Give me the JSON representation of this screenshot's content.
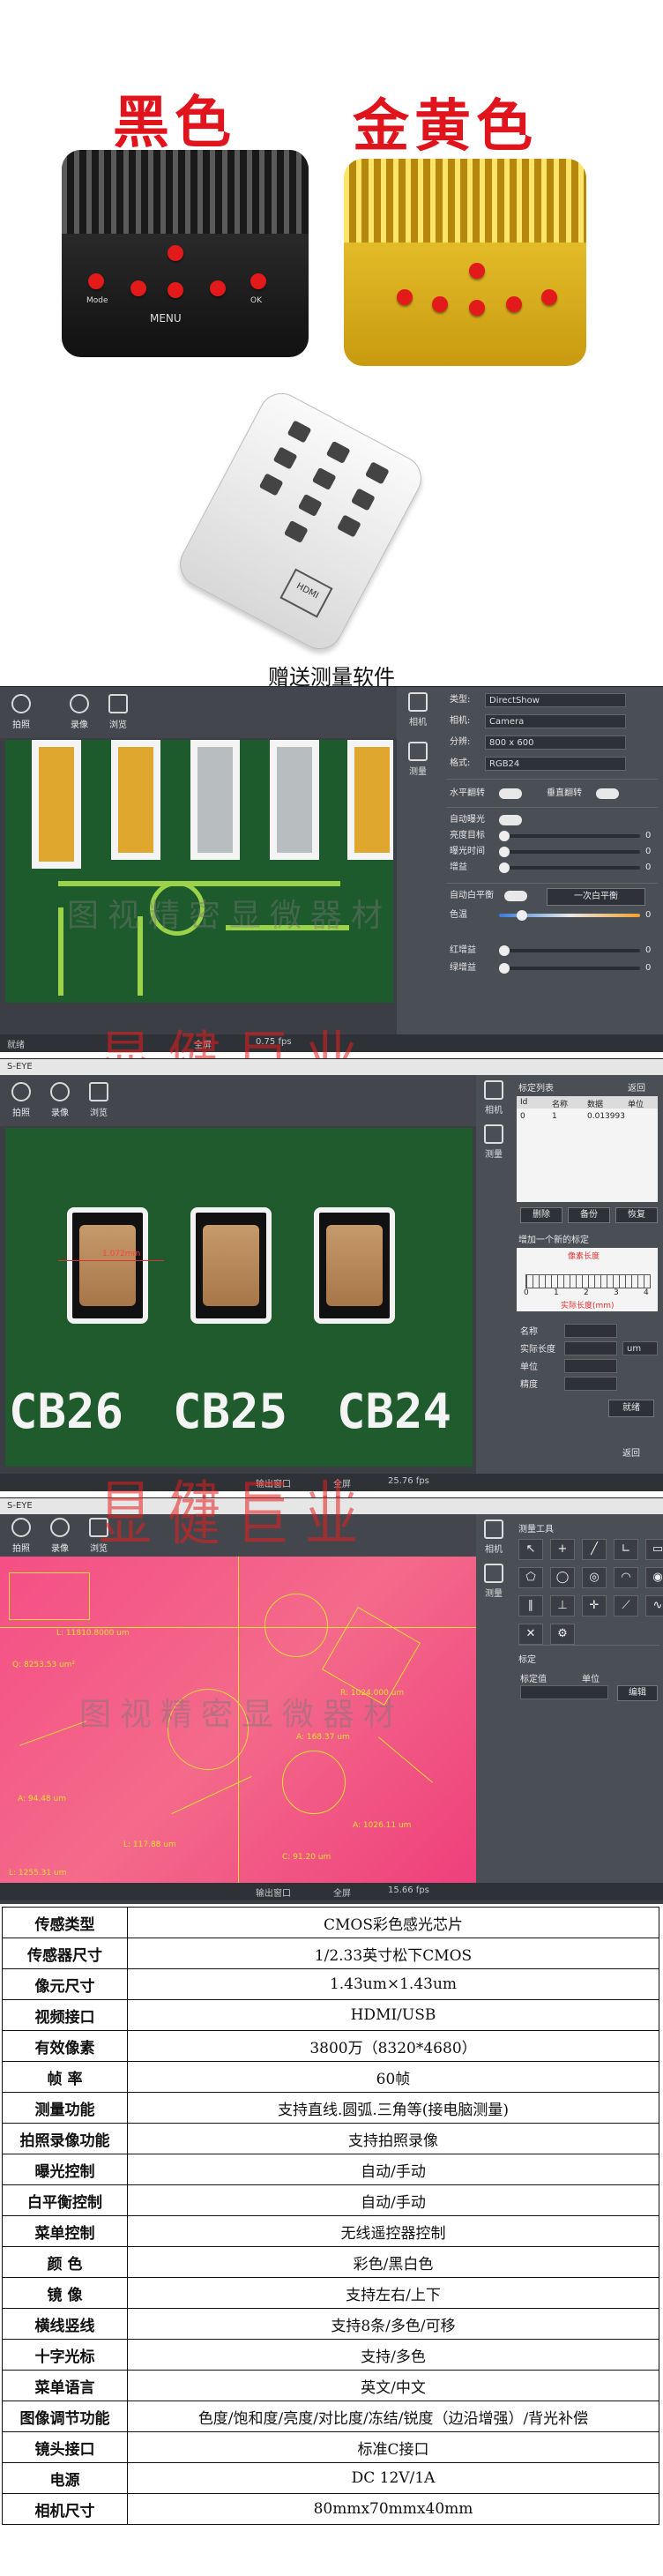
{
  "product": {
    "black_label": "黑色",
    "gold_label": "金黄色",
    "menu_label": "MENU",
    "button_labels": [
      "Mode",
      "OK"
    ],
    "remote_badge": "HDMI",
    "caption": "赠送测量软件"
  },
  "screens": [
    {
      "toolbar": [
        "拍照",
        "录像",
        "浏览"
      ],
      "side_tabs": [
        "相机",
        "测量"
      ],
      "fields": [
        {
          "label": "类型:",
          "value": "DirectShow"
        },
        {
          "label": "相机:",
          "value": "Camera"
        },
        {
          "label": "分辨:",
          "value": "800 x 600"
        },
        {
          "label": "格式:",
          "value": "RGB24"
        }
      ],
      "flip": [
        "水平翻转",
        "垂直翻转"
      ],
      "exposure": [
        {
          "label": "自动曝光",
          "value": ""
        },
        {
          "label": "亮度目标",
          "value": "0"
        },
        {
          "label": "曝光时间",
          "value": "0"
        },
        {
          "label": "增益",
          "value": "0"
        }
      ],
      "white_balance": {
        "label": "自动白平衡",
        "button": "一次白平衡"
      },
      "color": [
        {
          "label": "色温",
          "value": "0"
        },
        {
          "label": "红增益",
          "value": "0"
        },
        {
          "label": "绿增益",
          "value": "0"
        }
      ],
      "status": {
        "left": "就绪",
        "mid": "全屏",
        "fps": "0.75 fps"
      },
      "watermark": "图视精密显微器材"
    },
    {
      "app_title": "S-EYE",
      "toolbar": [
        "拍照",
        "录像",
        "浏览"
      ],
      "side_tabs": [
        "相机",
        "测量"
      ],
      "panel_header": "标定列表",
      "close_label": "返回",
      "table_headers": [
        "Id",
        "名称",
        "数据",
        "单位"
      ],
      "table_row": [
        "0",
        "1",
        "0.013993",
        ""
      ],
      "panel_buttons": [
        "删除",
        "备份",
        "恢复"
      ],
      "calib_title": "增加一个新的标定",
      "ruler_label": "像素长度",
      "ruler_bottom": "实际长度(mm)",
      "ruler_ticks": [
        "0",
        "1",
        "2",
        "3",
        "4"
      ],
      "fields": [
        "名称",
        "实际长度",
        "单位",
        "精度"
      ],
      "unit_value": "um",
      "confirm_button": "就绪",
      "bottom_button": "返回",
      "marker_label": "1.072mm",
      "chip_labels": [
        "CB26",
        "CB25",
        "CB24"
      ],
      "status": {
        "left": "输出窗口",
        "mid": "全屏",
        "fps": "25.76 fps"
      },
      "watermark": "显健巨业"
    },
    {
      "app_title": "S-EYE",
      "toolbar": [
        "拍照",
        "录像",
        "浏览"
      ],
      "side_tabs": [
        "相机",
        "测量"
      ],
      "panel_header": "测量工具",
      "calib_header": "标定",
      "calib_fields": [
        "标定值",
        "单位"
      ],
      "calib_button": "编辑",
      "measurements": [
        "L: 11810.8000 um",
        "Q: 8253.53 um²",
        "R: 1024.000 um",
        "A: 168.37 um",
        "L: 117.88 um",
        "C: 91.20 um",
        "A: 94.48 um",
        "L: 1255.31 um",
        "A: 1026.11 um"
      ],
      "status": {
        "left": "输出窗口",
        "mid": "全屏",
        "fps": "15.66 fps"
      },
      "watermark": "显健巨业",
      "watermark2": "图视精密显微器材"
    }
  ],
  "specs": [
    {
      "k": "传感类型",
      "v": "CMOS彩色感光芯片"
    },
    {
      "k": "传感器尺寸",
      "v": "1/2.33英寸松下CMOS"
    },
    {
      "k": "像元尺寸",
      "v": "1.43um×1.43um"
    },
    {
      "k": "视频接口",
      "v": "HDMI/USB"
    },
    {
      "k": "有效像素",
      "v": "3800万（8320*4680）"
    },
    {
      "k": "帧  率",
      "v": "60帧"
    },
    {
      "k": "测量功能",
      "v": "支持直线.圆弧.三角等(接电脑测量)"
    },
    {
      "k": "拍照录像功能",
      "v": "支持拍照录像"
    },
    {
      "k": "曝光控制",
      "v": "自动/手动"
    },
    {
      "k": "白平衡控制",
      "v": "自动/手动"
    },
    {
      "k": "菜单控制",
      "v": "无线遥控器控制"
    },
    {
      "k": "颜  色",
      "v": "彩色/黑白色"
    },
    {
      "k": "镜  像",
      "v": "支持左右/上下"
    },
    {
      "k": "横线竖线",
      "v": "支持8条/多色/可移"
    },
    {
      "k": "十字光标",
      "v": "支持/多色"
    },
    {
      "k": "菜单语言",
      "v": "英文/中文"
    },
    {
      "k": "图像调节功能",
      "v": "色度/饱和度/亮度/对比度/冻结/锐度（边沿增强）/背光补偿"
    },
    {
      "k": "镜头接口",
      "v": "标准C接口"
    },
    {
      "k": "电源",
      "v": "DC 12V/1A"
    },
    {
      "k": "相机尺寸",
      "v": "80mmx70mmx40mm"
    }
  ]
}
